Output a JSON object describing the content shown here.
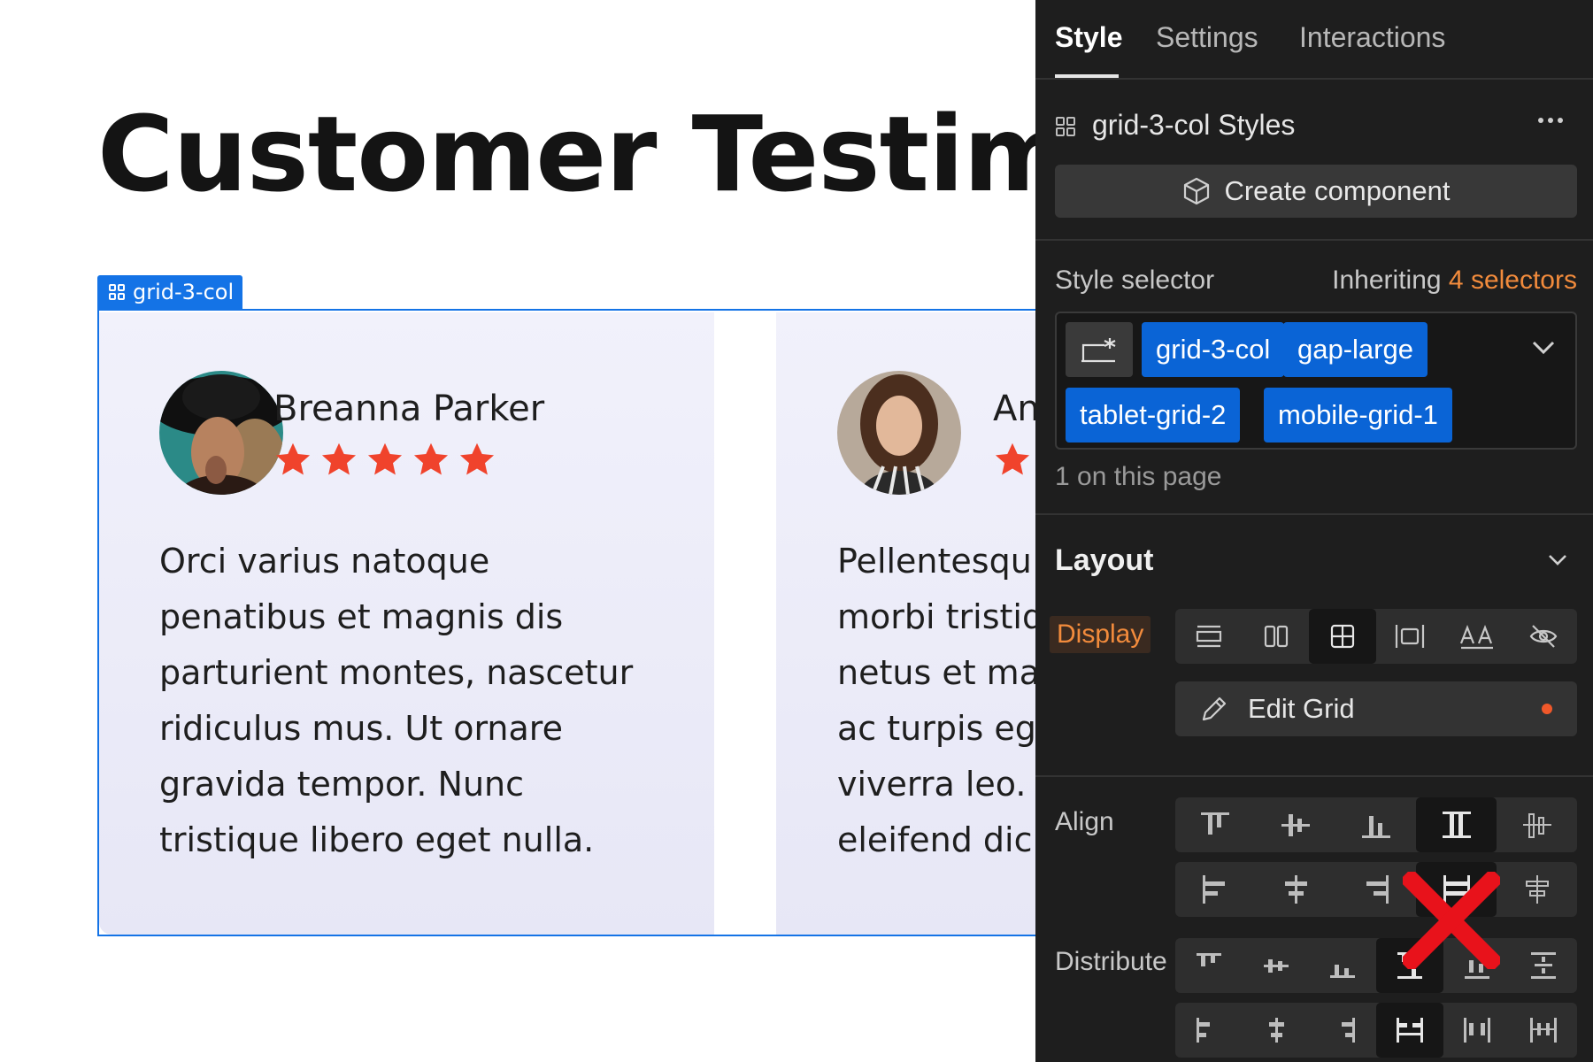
{
  "canvas": {
    "title": "Customer Testimon",
    "grid_tag_label": "grid-3-col",
    "cards": [
      {
        "name": "Breanna Parker",
        "rating": 5,
        "text_lines": [
          "Orci varius natoque",
          "penatibus et magnis dis",
          "parturient montes, nascetur",
          "ridiculus mus. Ut ornare",
          "gravida tempor. Nunc",
          "tristique libero eget nulla."
        ]
      },
      {
        "name": "An",
        "rating": 1,
        "text_lines": [
          "Pellentesqu",
          "morbi tristiq",
          "netus et ma",
          "ac turpis eg",
          "viverra leo.",
          "eleifend dic"
        ]
      }
    ],
    "star_color": "#f0432c",
    "selection_color": "#1473e6"
  },
  "panel": {
    "tabs": [
      {
        "label": "Style",
        "active": true
      },
      {
        "label": "Settings",
        "active": false
      },
      {
        "label": "Interactions",
        "active": false
      }
    ],
    "styles_header": "grid-3-col Styles",
    "create_component_label": "Create component",
    "style_selector_label": "Style selector",
    "inheriting_prefix": "Inheriting",
    "inheriting_count": "4 selectors",
    "selector_chips": [
      "grid-3-col",
      "gap-large",
      "tablet-grid-2",
      "mobile-grid-1"
    ],
    "on_page_text": "1 on this page",
    "layout_header": "Layout",
    "display_label": "Display",
    "display_options": [
      "block-icon",
      "flex-icon",
      "grid-icon",
      "inline-block-icon",
      "inline-text-icon",
      "none-hidden-icon"
    ],
    "display_active": 2,
    "edit_grid_label": "Edit Grid",
    "align_label": "Align",
    "distribute_label": "Distribute",
    "accent_color": "#f28b3c",
    "chip_color": "#0a64d6"
  }
}
